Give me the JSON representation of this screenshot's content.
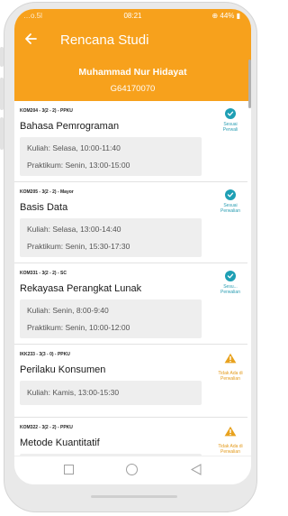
{
  "status_bar": {
    "left": "…o.5l",
    "time": "08:21",
    "right": "⊕ 44% ▮"
  },
  "header": {
    "title": "Rencana Studi",
    "name": "Muhammad Nur Hidayat",
    "id": "G64170070"
  },
  "courses": [
    {
      "code": "KOM204 - 3(2 - 2) - PPKU",
      "name": "Bahasa Pemrograman",
      "schedule": [
        "Kuliah: Selasa, 10:00-11:40",
        "Praktikum: Senin, 13:00-15:00"
      ],
      "status": "ok",
      "status_label": [
        "Sesuai",
        "Perwali"
      ]
    },
    {
      "code": "KOM205 - 3(2 - 2) - Mayor",
      "name": "Basis Data",
      "schedule": [
        "Kuliah: Selasa, 13:00-14:40",
        "Praktikum: Senin, 15:30-17:30"
      ],
      "status": "ok",
      "status_label": [
        "Sesuai",
        "Perwalian"
      ]
    },
    {
      "code": "KOM331 - 3(2 - 2) - SC",
      "name": "Rekayasa Perangkat Lunak",
      "schedule": [
        "Kuliah: Senin, 8:00-9:40",
        "Praktikum: Senin, 10:00-12:00"
      ],
      "status": "ok",
      "status_label": [
        "Sesu...",
        "Perwalian"
      ]
    },
    {
      "code": "IKK233 - 3(3 - 0) - PPKU",
      "name": "Perilaku Konsumen",
      "schedule": [
        "Kuliah: Kamis, 13:00-15:30"
      ],
      "status": "warn",
      "status_label": [
        "Tidak Ada di",
        "Perwalian"
      ]
    },
    {
      "code": "KOM322 - 3(2 - 2) - PPKU",
      "name": "Metode Kuantitatif",
      "schedule": [],
      "status": "warn",
      "status_label": [
        "Tidak Ada di",
        "Perwalian"
      ]
    }
  ],
  "colors": {
    "header": "#f7a11c",
    "ok": "#1e9fb4",
    "warn": "#e39a1b"
  }
}
